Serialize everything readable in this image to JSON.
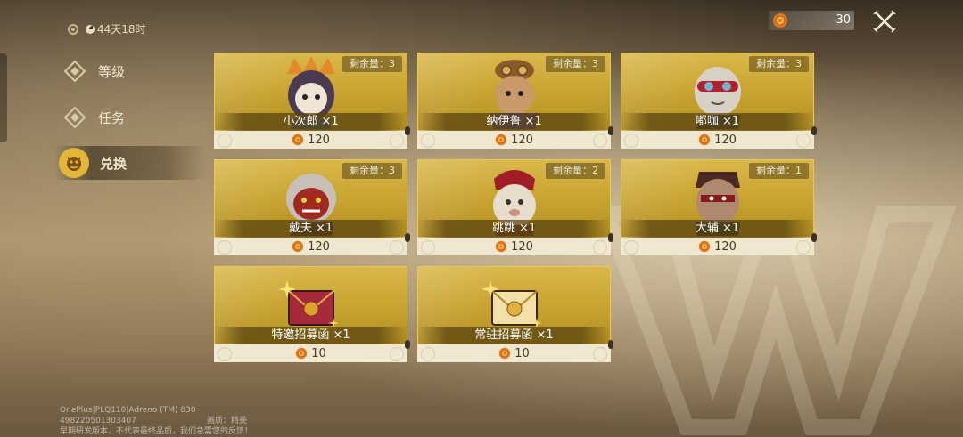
{
  "timer": {
    "text": "44天18时"
  },
  "nav": {
    "items": [
      {
        "label": "等级"
      },
      {
        "label": "任务"
      },
      {
        "label": "兑换"
      }
    ]
  },
  "currency": {
    "amount": "30",
    "icon": "gear-coin-icon"
  },
  "cards": [
    {
      "remain": "剩余量：3",
      "name": "小次郎 ×1",
      "price": "120",
      "kind": "hero"
    },
    {
      "remain": "剩余量：3",
      "name": "纳伊鲁 ×1",
      "price": "120",
      "kind": "hero"
    },
    {
      "remain": "剩余量：3",
      "name": "嘟咖 ×1",
      "price": "120",
      "kind": "hero"
    },
    {
      "remain": "剩余量：3",
      "name": "戴夫 ×1",
      "price": "120",
      "kind": "hero"
    },
    {
      "remain": "剩余量：2",
      "name": "跳跳 ×1",
      "price": "120",
      "kind": "hero"
    },
    {
      "remain": "剩余量：1",
      "name": "大辅 ×1",
      "price": "120",
      "kind": "hero"
    },
    {
      "remain": "",
      "name": "特邀招募函 ×1",
      "price": "10",
      "kind": "red-letter"
    },
    {
      "remain": "",
      "name": "常驻招募函 ×1",
      "price": "10",
      "kind": "gold-letter"
    }
  ],
  "footer": {
    "line1": "OnePlus|PLQ110|Adreno (TM) 830",
    "line2": "498220501303407",
    "line2b": "画质：精美",
    "line3": "早期研发版本，不代表最终品质，我们急需您的反馈！"
  },
  "colors": {
    "card_gold": "#caa633",
    "card_bottom": "#efe7d0",
    "nav_active": "#e3b63a"
  }
}
